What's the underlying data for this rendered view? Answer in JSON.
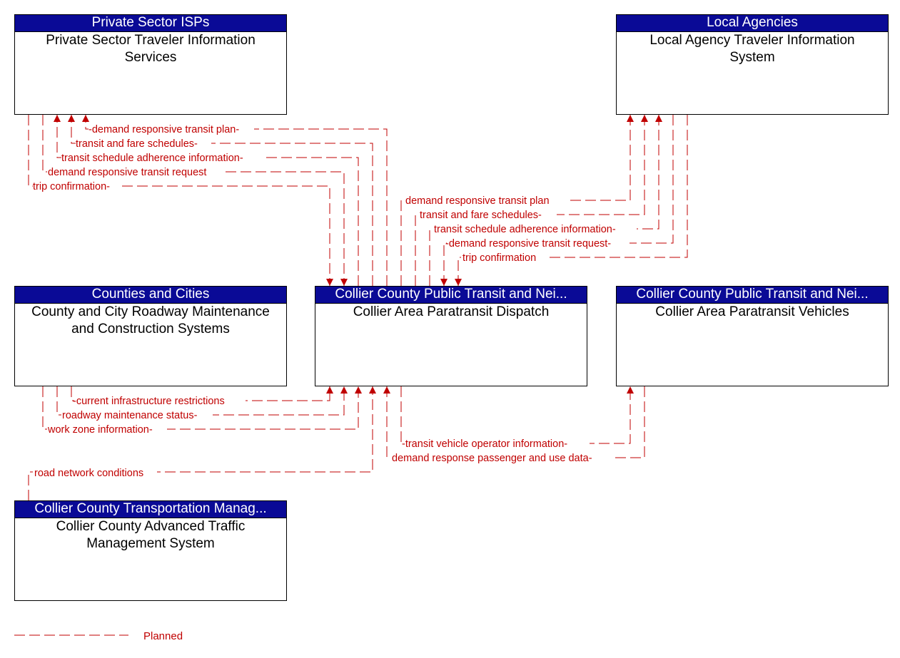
{
  "colors": {
    "flow": "#c00000",
    "header_bg": "#0a0a96",
    "header_text": "#ffffff"
  },
  "nodes": {
    "private_isp": {
      "header": "Private Sector ISPs",
      "title": "Private Sector Traveler Information Services"
    },
    "local_agencies": {
      "header": "Local Agencies",
      "title": "Local Agency Traveler Information System"
    },
    "counties": {
      "header": "Counties and Cities",
      "title": "County and City Roadway Maintenance and Construction Systems"
    },
    "dispatch": {
      "header": "Collier County Public Transit and Nei...",
      "title": "Collier Area Paratransit Dispatch"
    },
    "vehicles": {
      "header": "Collier County Public Transit and Nei...",
      "title": "Collier Area Paratransit Vehicles"
    },
    "atms": {
      "header": "Collier County Transportation Manag...",
      "title": "Collier County Advanced Traffic Management System"
    }
  },
  "flows": {
    "p1": "-demand responsive transit plan-",
    "p2": "transit and fare schedules-",
    "p3": "transit schedule adherence information-",
    "p4": "demand responsive transit request",
    "p5": "trip confirmation-",
    "l1": "demand responsive transit plan",
    "l2": "transit and fare schedules-",
    "l3": "transit schedule adherence information-",
    "l4": "-demand responsive transit request-",
    "l5": "trip confirmation",
    "c1": "-current infrastructure restrictions",
    "c2": "roadway maintenance status-",
    "c3": "work zone information-",
    "a1": "road network conditions",
    "v1": "-transit vehicle operator information-",
    "v2": "demand response passenger and use data-"
  },
  "legend": {
    "planned_label": "Planned"
  }
}
